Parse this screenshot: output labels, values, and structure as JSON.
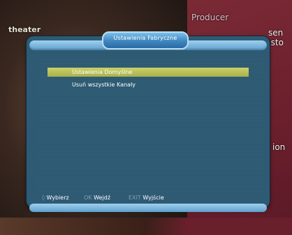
{
  "background": {
    "left_text": "theater",
    "producer_label": "Producer",
    "right_fragment_1": "sen",
    "right_fragment_2": "nsto",
    "right_fragment_3": "ion"
  },
  "dialog": {
    "title": "Ustawienia Fabryczne",
    "menu": [
      {
        "label": "Ustawienia Domyślne",
        "selected": true
      },
      {
        "label": "Usuń wszystkie Kanały",
        "selected": false
      }
    ]
  },
  "status_bar": {
    "select_key": "◊",
    "select_label": "Wybierz",
    "ok_key": "OK",
    "ok_label": "Wejdź",
    "exit_key": "EXIT",
    "exit_label": "Wyjście"
  },
  "colors": {
    "panel": "#2e5a74",
    "highlight": "#bcc25a",
    "accent_bar": "#7cbce6",
    "tv_right": "#6a1f2c"
  }
}
